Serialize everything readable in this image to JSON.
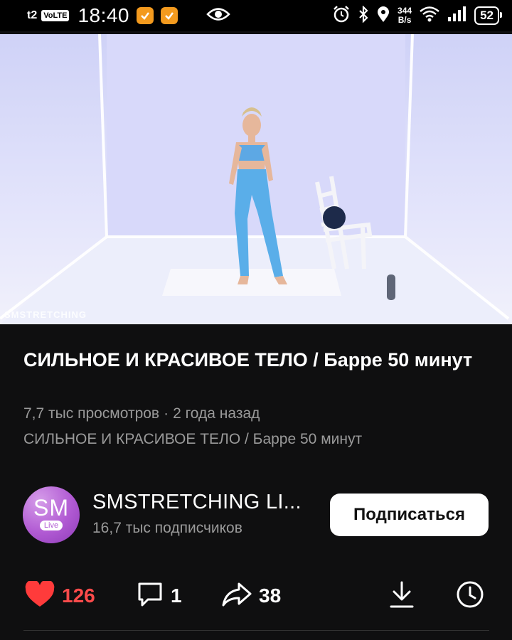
{
  "status_bar": {
    "carrier": "t2",
    "volte": "VoLTE",
    "time": "18:40",
    "net_speed_value": "344",
    "net_speed_unit": "B/s",
    "battery": "52",
    "icons": [
      "app-badge-icon",
      "app-badge-icon",
      "eye-icon",
      "alarm-icon",
      "bluetooth-icon",
      "location-icon",
      "wifi-icon",
      "signal-icon",
      "battery-icon"
    ]
  },
  "video": {
    "watermark": "SMSTRETCHING"
  },
  "info": {
    "title": "СИЛЬНОЕ И КРАСИВОЕ ТЕЛО / Барре 50 минут",
    "views": "7,7 тыс просмотров",
    "separator": "·",
    "age": "2 года назад",
    "description": "СИЛЬНОЕ И КРАСИВОЕ ТЕЛО / Барре 50 минут"
  },
  "channel": {
    "avatar_text": "SM",
    "avatar_badge": "Live",
    "name": "SMSTRETCHING LI...",
    "subscribers": "16,7 тыс подписчиков",
    "subscribe_label": "Подписаться"
  },
  "actions": {
    "likes": "126",
    "comments": "1",
    "shares": "38",
    "like_color": "#ff3b3b"
  }
}
